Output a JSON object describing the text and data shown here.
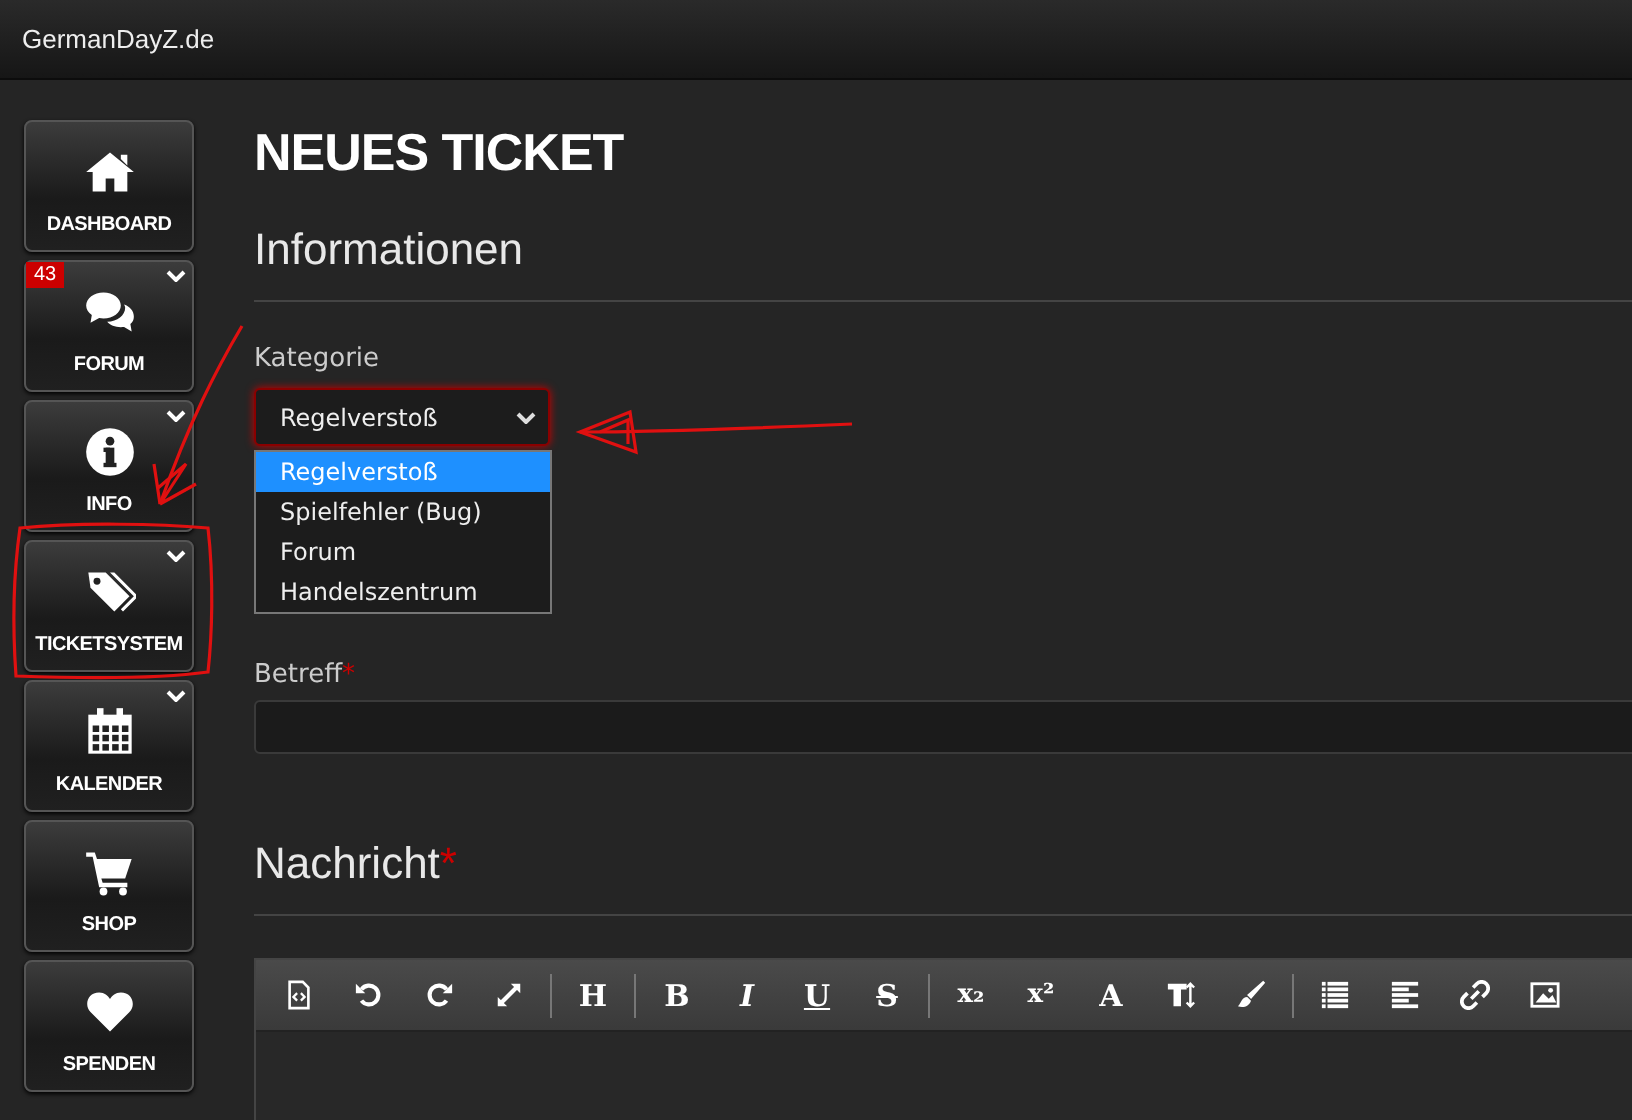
{
  "site": {
    "title": "GermanDayZ.de"
  },
  "sidebar": {
    "items": [
      {
        "label": "DASHBOARD",
        "expandable": false
      },
      {
        "label": "FORUM",
        "badge": "43",
        "expandable": true
      },
      {
        "label": "INFO",
        "expandable": true
      },
      {
        "label": "TICKETSYSTEM",
        "expandable": true
      },
      {
        "label": "KALENDER",
        "expandable": true
      },
      {
        "label": "SHOP",
        "expandable": false
      },
      {
        "label": "SPENDEN",
        "expandable": false
      }
    ]
  },
  "page": {
    "title": "NEUES TICKET",
    "section": "Informationen",
    "category": {
      "label": "Kategorie",
      "value": "Regelverstoß",
      "expanded": true,
      "options": [
        {
          "label": "Regelverstoß",
          "selected": true
        },
        {
          "label": "Spielfehler (Bug)",
          "selected": false
        },
        {
          "label": "Forum",
          "selected": false
        },
        {
          "label": "Handelszentrum",
          "selected": false
        }
      ]
    },
    "subject": {
      "label": "Betreff",
      "required_mark": "*"
    },
    "message": {
      "heading": "Nachricht",
      "required_mark": "*",
      "toolbar": [
        [
          {
            "kind": "icon"
          },
          {
            "kind": "icon"
          },
          {
            "kind": "icon"
          },
          {
            "kind": "icon"
          }
        ],
        [
          {
            "kind": "glyph",
            "label": "H"
          }
        ],
        [
          {
            "kind": "glyph",
            "label": "B"
          },
          {
            "kind": "glyph",
            "label": "I"
          },
          {
            "kind": "glyph",
            "label": "U"
          },
          {
            "kind": "glyph",
            "label": "S"
          }
        ],
        [
          {
            "kind": "glyph",
            "label": "x₂"
          },
          {
            "kind": "glyph",
            "label": "x²"
          },
          {
            "kind": "glyph",
            "label": "A"
          },
          {
            "kind": "icon"
          },
          {
            "kind": "icon"
          }
        ],
        [
          {
            "kind": "icon"
          },
          {
            "kind": "icon"
          },
          {
            "kind": "icon"
          },
          {
            "kind": "icon"
          }
        ]
      ]
    }
  }
}
